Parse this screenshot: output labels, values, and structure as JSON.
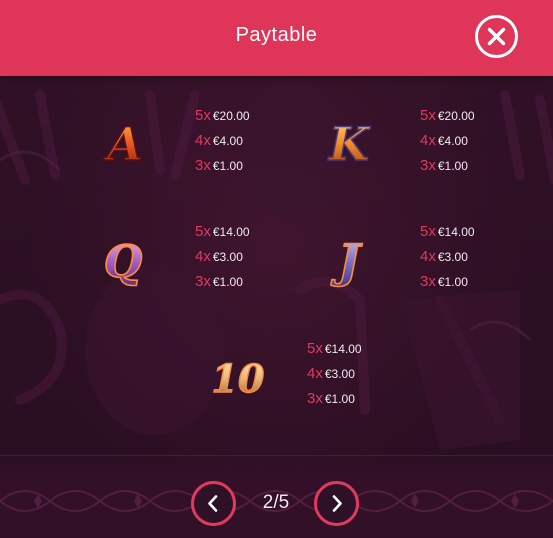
{
  "header": {
    "title": "Paytable"
  },
  "symbols": [
    {
      "name": "A",
      "glyph": "A",
      "pays": [
        {
          "mult": "5x",
          "amount": "€20.00"
        },
        {
          "mult": "4x",
          "amount": "€4.00"
        },
        {
          "mult": "3x",
          "amount": "€1.00"
        }
      ]
    },
    {
      "name": "K",
      "glyph": "K",
      "pays": [
        {
          "mult": "5x",
          "amount": "€20.00"
        },
        {
          "mult": "4x",
          "amount": "€4.00"
        },
        {
          "mult": "3x",
          "amount": "€1.00"
        }
      ]
    },
    {
      "name": "Q",
      "glyph": "Q",
      "pays": [
        {
          "mult": "5x",
          "amount": "€14.00"
        },
        {
          "mult": "4x",
          "amount": "€3.00"
        },
        {
          "mult": "3x",
          "amount": "€1.00"
        }
      ]
    },
    {
      "name": "J",
      "glyph": "J",
      "pays": [
        {
          "mult": "5x",
          "amount": "€14.00"
        },
        {
          "mult": "4x",
          "amount": "€3.00"
        },
        {
          "mult": "3x",
          "amount": "€1.00"
        }
      ]
    },
    {
      "name": "10",
      "glyph": "10",
      "pays": [
        {
          "mult": "5x",
          "amount": "€14.00"
        },
        {
          "mult": "4x",
          "amount": "€3.00"
        },
        {
          "mult": "3x",
          "amount": "€1.00"
        }
      ]
    }
  ],
  "pagination": {
    "current": "2/5"
  },
  "colors": {
    "header": "#df3558",
    "accent": "#e03a5d",
    "background": "#2b0f23",
    "text": "#f2eaf0"
  },
  "icons": {
    "close": "close-icon",
    "prev": "chevron-left-icon",
    "next": "chevron-right-icon"
  }
}
